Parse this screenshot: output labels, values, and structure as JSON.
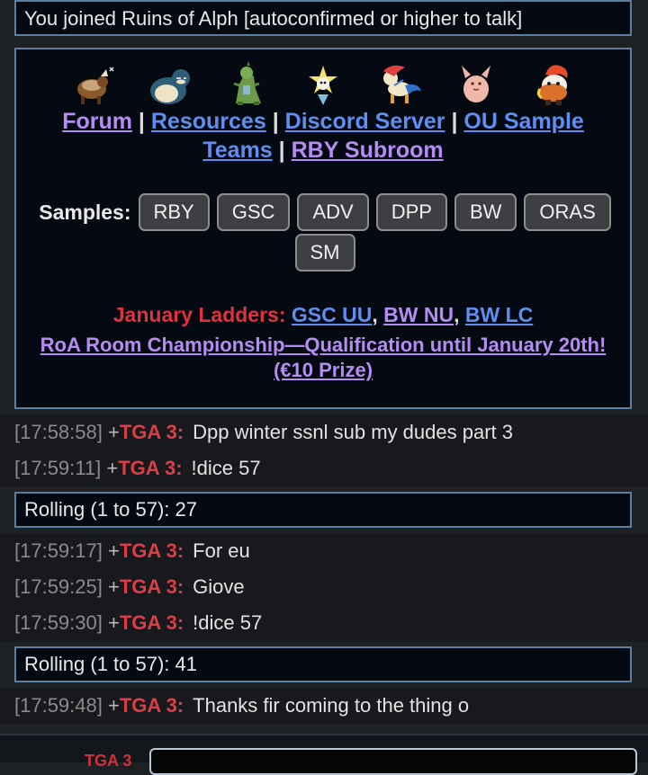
{
  "notice": "You joined Ruins of Alph [autoconfirmed or higher to talk]",
  "sprites": [
    "tauros-icon",
    "snorlax-icon",
    "tyranitar-icon",
    "jirachi-icon",
    "keldeo-icon",
    "clefable-icon",
    "infernape-icon"
  ],
  "links": {
    "forum": "Forum",
    "resources": "Resources",
    "discord": "Discord Server",
    "ou_sample": "OU Sample",
    "teams": "Teams",
    "rby_subroom": "RBY Subroom",
    "sep": "|"
  },
  "samples": {
    "label": "Samples:",
    "buttons": [
      "RBY",
      "GSC",
      "ADV",
      "DPP",
      "BW",
      "ORAS",
      "SM"
    ]
  },
  "ladders": {
    "label": "January Ladders:",
    "items": [
      "GSC UU",
      "BW NU",
      "BW LC"
    ],
    "comma": ","
  },
  "championship": "RoA Room Championship—Qualification until January 20th! (€10 Prize)",
  "chat": [
    {
      "time": "[17:58:58]",
      "rank": "+",
      "user": "TGA 3:",
      "msg": "Dpp winter ssnl sub my dudes part 3"
    },
    {
      "time": "[17:59:11]",
      "rank": "+",
      "user": "TGA 3:",
      "msg": "!dice 57"
    },
    {
      "roll": "Rolling (1 to 57): 27"
    },
    {
      "time": "[17:59:17]",
      "rank": "+",
      "user": "TGA 3:",
      "msg": "For eu"
    },
    {
      "time": "[17:59:25]",
      "rank": "+",
      "user": "TGA 3:",
      "msg": "Giove"
    },
    {
      "time": "[17:59:30]",
      "rank": "+",
      "user": "TGA 3:",
      "msg": "!dice 57"
    },
    {
      "roll": "Rolling (1 to 57): 41"
    },
    {
      "time": "[17:59:48]",
      "rank": "+",
      "user": "TGA 3:",
      "msg": "Thanks fir coming to the thing o"
    }
  ],
  "composer": {
    "name": "TGA 3"
  }
}
